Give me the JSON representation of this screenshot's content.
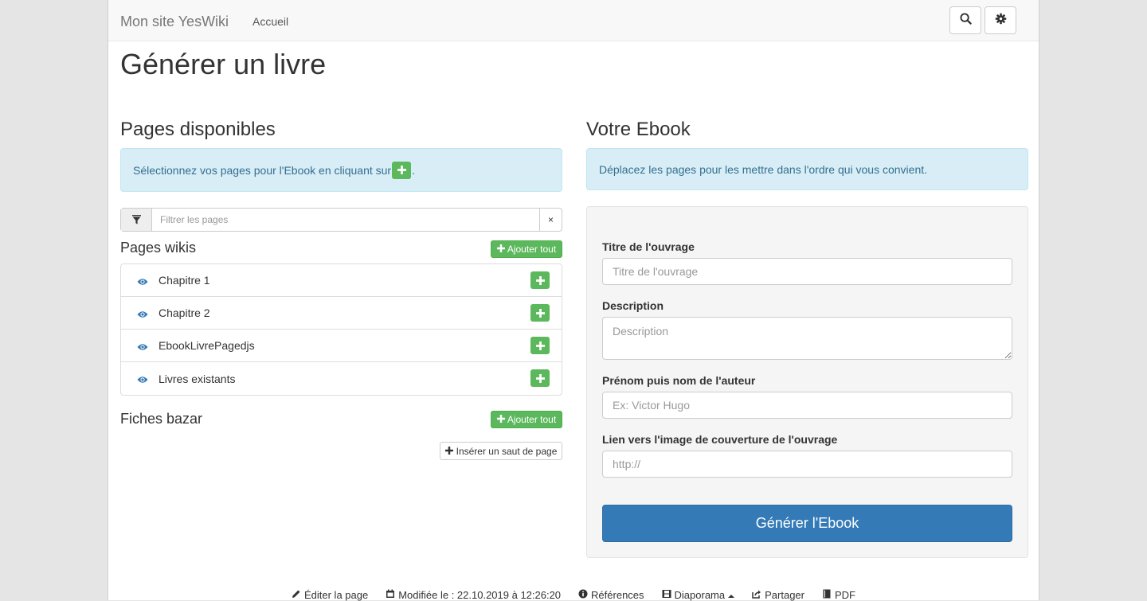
{
  "navbar": {
    "brand": "Mon site YesWiki",
    "links": [
      "Accueil"
    ],
    "search_icon": "search-icon",
    "settings_icon": "gear-icon"
  },
  "page_title": "Générer un livre",
  "left": {
    "heading": "Pages disponibles",
    "info_before": "Sélectionnez vos pages pour l'Ebook en cliquant sur ",
    "info_after": ".",
    "filter": {
      "placeholder": "Filtrer les pages",
      "value": "",
      "clear": "×"
    },
    "wiki_section": {
      "title": "Pages wikis",
      "add_all_label": "Ajouter tout",
      "items": [
        {
          "label": "Chapitre 1"
        },
        {
          "label": "Chapitre 2"
        },
        {
          "label": "EbookLivrePagedjs"
        },
        {
          "label": "Livres existants"
        }
      ]
    },
    "bazar_section": {
      "title": "Fiches bazar",
      "add_all_label": "Ajouter tout"
    },
    "page_break_label": "Insérer un saut de page"
  },
  "right": {
    "heading": "Votre Ebook",
    "info": "Déplacez les pages pour les mettre dans l'ordre qui vous convient.",
    "form": {
      "title_label": "Titre de l'ouvrage",
      "title_placeholder": "Titre de l'ouvrage",
      "title_value": "",
      "description_label": "Description",
      "description_placeholder": "Description",
      "description_value": "",
      "author_label": "Prénom puis nom de l'auteur",
      "author_placeholder": "Ex: Victor Hugo",
      "author_value": "",
      "cover_label": "Lien vers l'image de couverture de l'ouvrage",
      "cover_placeholder": "http://",
      "cover_value": "",
      "submit_label": "Générer l'Ebook"
    }
  },
  "footer": {
    "edit": "Éditer la page",
    "modified": "Modifiée le : 22.10.2019 à 12:26:20",
    "references": "Références",
    "slideshow": "Diaporama",
    "share": "Partager",
    "pdf": "PDF"
  },
  "colors": {
    "success": "#5cb85c",
    "primary": "#337ab7",
    "info_bg": "#d9edf7",
    "info_text": "#31708f"
  }
}
